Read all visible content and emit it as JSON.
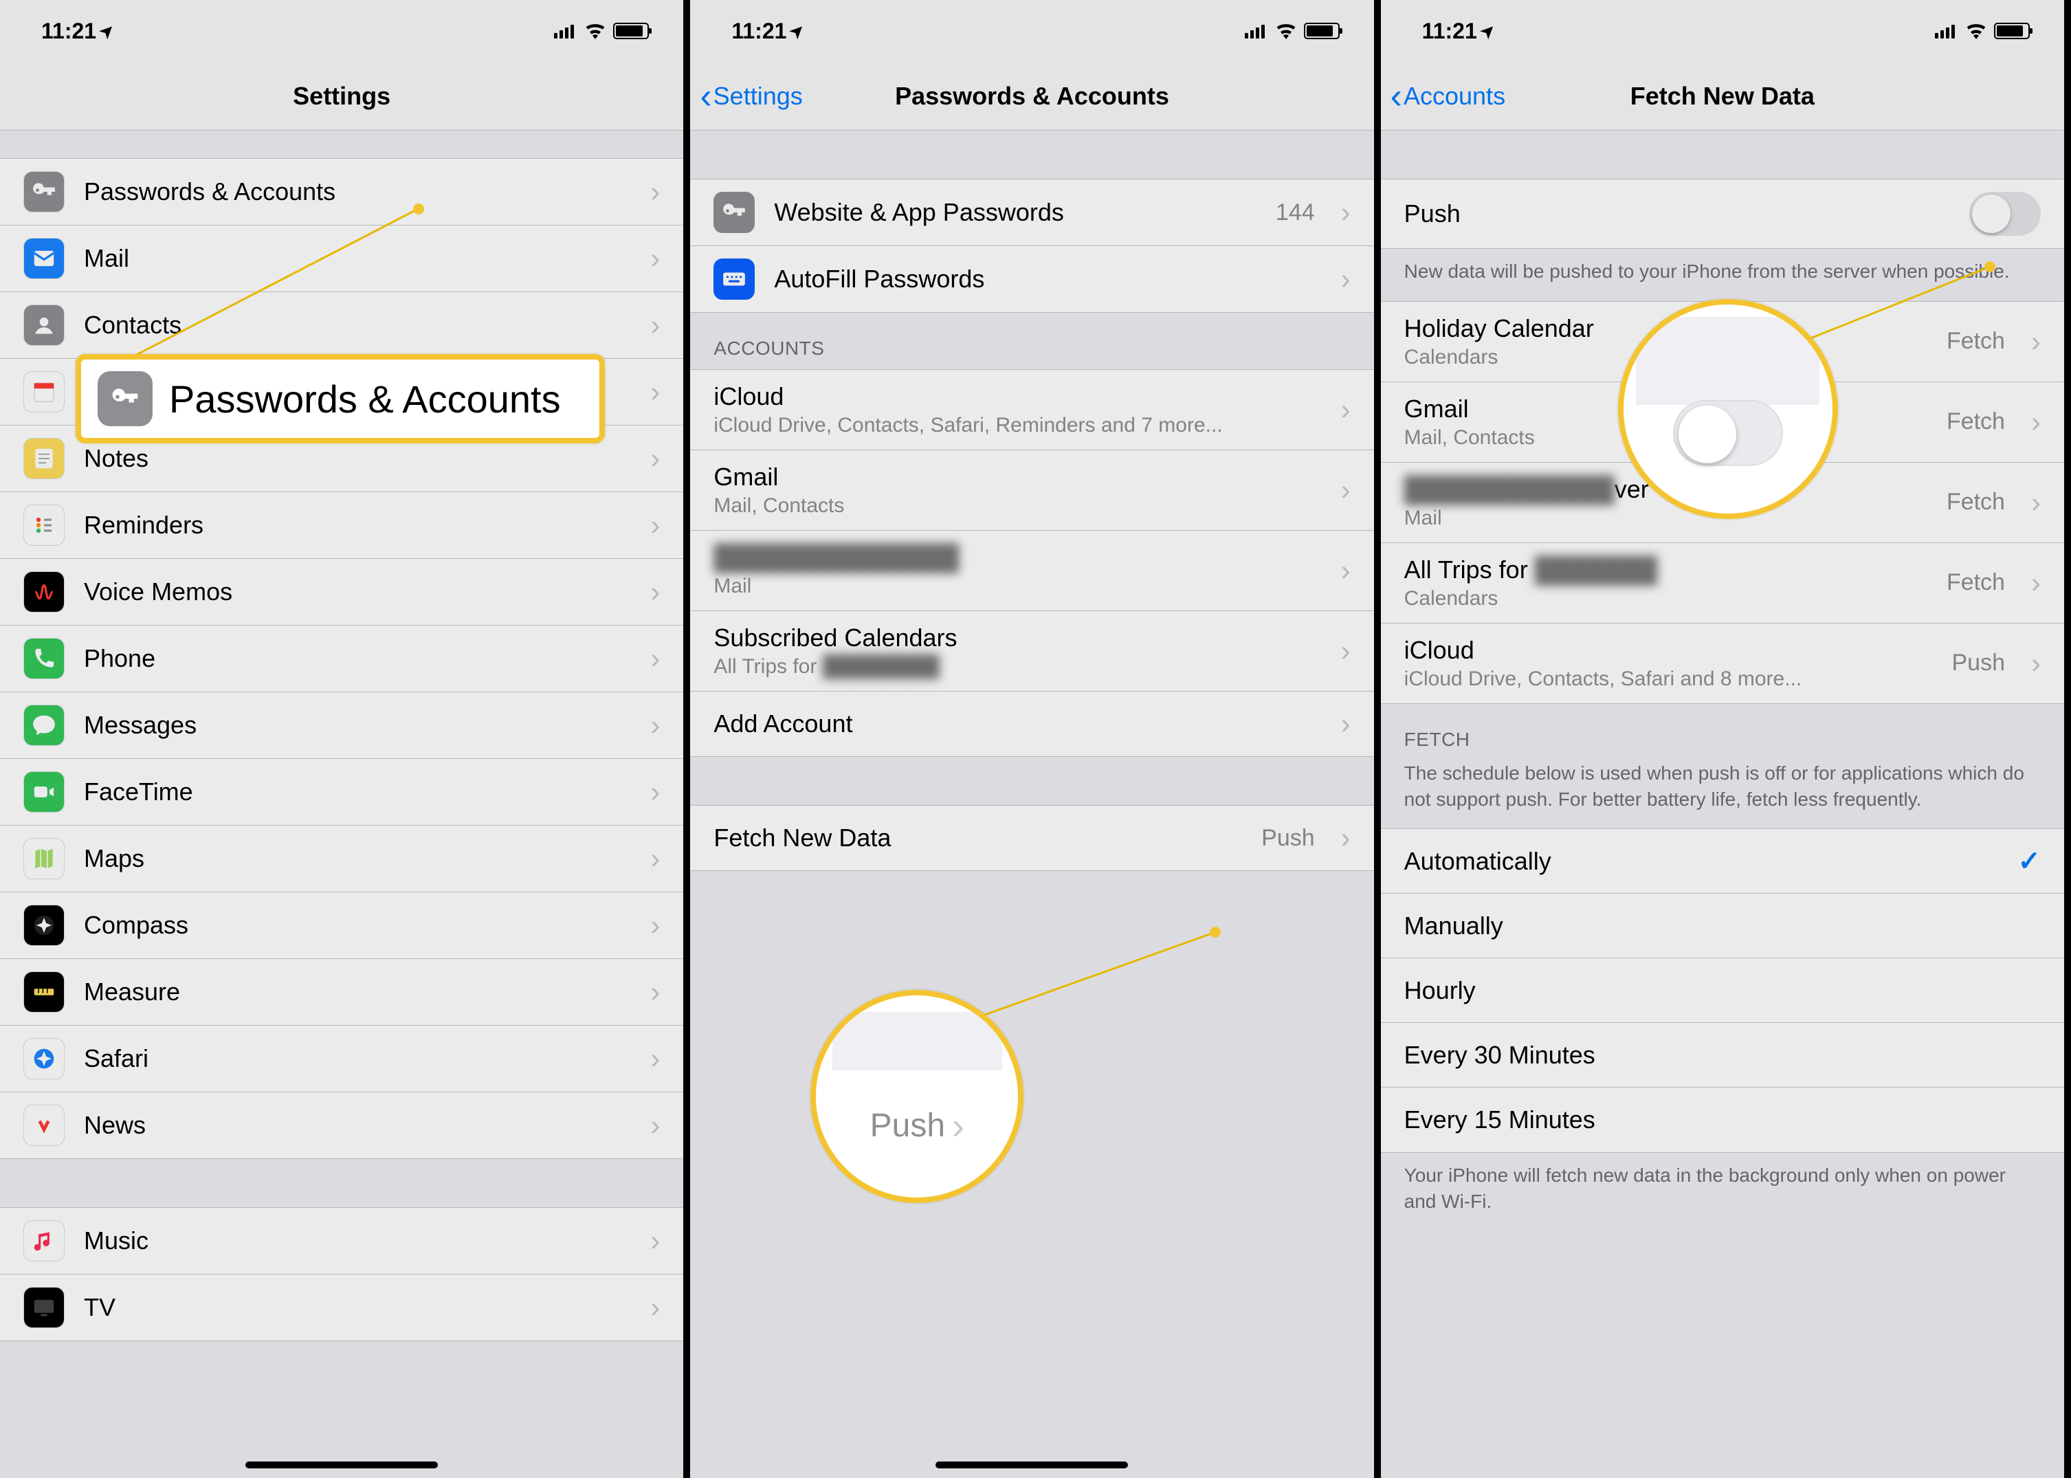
{
  "status": {
    "time": "11:21",
    "loc_arrow": "➤"
  },
  "p1": {
    "title": "Settings",
    "rows": [
      {
        "label": "Passwords & Accounts",
        "icon": "key",
        "bg": "#8e8e93"
      },
      {
        "label": "Mail",
        "icon": "mail",
        "bg": "#1a84ff"
      },
      {
        "label": "Contacts",
        "icon": "contacts",
        "bg": "#8e8e93"
      },
      {
        "label": "Calendar",
        "icon": "calendar",
        "bg": "#ffffff"
      },
      {
        "label": "Notes",
        "icon": "notes",
        "bg": "#fedd5b"
      },
      {
        "label": "Reminders",
        "icon": "reminders",
        "bg": "#ffffff"
      },
      {
        "label": "Voice Memos",
        "icon": "voicememos",
        "bg": "#000000"
      },
      {
        "label": "Phone",
        "icon": "phone",
        "bg": "#34c759"
      },
      {
        "label": "Messages",
        "icon": "messages",
        "bg": "#34c759"
      },
      {
        "label": "FaceTime",
        "icon": "facetime",
        "bg": "#34c759"
      },
      {
        "label": "Maps",
        "icon": "maps",
        "bg": "#ffffff"
      },
      {
        "label": "Compass",
        "icon": "compass",
        "bg": "#000000"
      },
      {
        "label": "Measure",
        "icon": "measure",
        "bg": "#000000"
      },
      {
        "label": "Safari",
        "icon": "safari",
        "bg": "#ffffff"
      },
      {
        "label": "News",
        "icon": "news",
        "bg": "#ffffff"
      }
    ],
    "rows2": [
      {
        "label": "Music",
        "icon": "music",
        "bg": "#ffffff"
      },
      {
        "label": "TV",
        "icon": "tv",
        "bg": "#000000"
      }
    ],
    "callout_label": "Passwords & Accounts"
  },
  "p2": {
    "back": "Settings",
    "title": "Passwords & Accounts",
    "top": [
      {
        "label": "Website & App Passwords",
        "value": "144",
        "icon": "key",
        "bg": "#8e8e93"
      },
      {
        "label": "AutoFill Passwords",
        "icon": "keyboard",
        "bg": "#0a60ff"
      }
    ],
    "accounts_header": "ACCOUNTS",
    "accounts": [
      {
        "label": "iCloud",
        "sub": "iCloud Drive, Contacts, Safari, Reminders and 7 more..."
      },
      {
        "label": "Gmail",
        "sub": "Mail, Contacts"
      },
      {
        "label": "██████████████",
        "sub": "Mail",
        "blur": true
      },
      {
        "label": "Subscribed Calendars",
        "sub": "All Trips for  ████████",
        "subblur": true
      },
      {
        "label": "Add Account"
      }
    ],
    "fetch": {
      "label": "Fetch New Data",
      "value": "Push"
    },
    "callout_value": "Push"
  },
  "p3": {
    "back": "Accounts",
    "title": "Fetch New Data",
    "push_label": "Push",
    "push_footer": "New data will be pushed to your iPhone from the server when possible.",
    "accounts": [
      {
        "label": "Holiday Calendar",
        "sub": "Calendars",
        "value": "Fetch"
      },
      {
        "label": "Gmail",
        "sub": "Mail, Contacts",
        "value": "Fetch"
      },
      {
        "label": "████████████ver",
        "sub": "Mail",
        "value": "Fetch",
        "blur": true
      },
      {
        "label": "All Trips for  ███████",
        "sub": "Calendars",
        "value": "Fetch",
        "subblur": true
      },
      {
        "label": "iCloud",
        "sub": "iCloud Drive, Contacts, Safari and 8 more...",
        "value": "Push"
      }
    ],
    "fetch_header": "FETCH",
    "fetch_footer_top": "The schedule below is used when push is off or for applications which do not support push. For better battery life, fetch less frequently.",
    "options": [
      "Automatically",
      "Manually",
      "Hourly",
      "Every 30 Minutes",
      "Every 15 Minutes"
    ],
    "selected": 0,
    "fetch_footer_bottom": "Your iPhone will fetch new data in the background only when on power and Wi-Fi."
  }
}
